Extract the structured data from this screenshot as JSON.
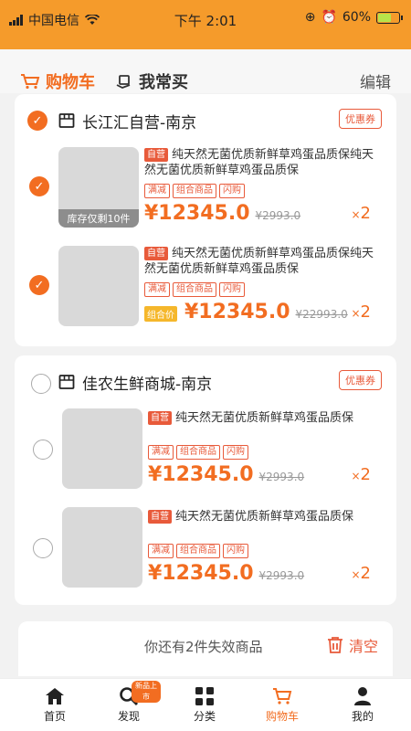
{
  "status_bar": {
    "carrier": "中国电信",
    "time": "下午 2:01",
    "battery": "60%"
  },
  "tabs": {
    "cart": "购物车",
    "often": "我常买",
    "edit": "编辑"
  },
  "shops": [
    {
      "name": "长江汇自营-南京",
      "coupon": "优惠券",
      "items": [
        {
          "badge": "自营",
          "title": "纯天然无菌优质新鲜草鸡蛋品质保纯天然无菌优质新鲜草鸡蛋品质保",
          "tags": [
            "满减",
            "组合商品",
            "闪购"
          ],
          "price": "¥12345.0",
          "old_price": "¥2993.0",
          "qty_x": "×",
          "qty": "2",
          "stock_tip": "库存仅剩10件"
        },
        {
          "badge": "自营",
          "title": "纯天然无菌优质新鲜草鸡蛋品质保纯天然无菌优质新鲜草鸡蛋品质保",
          "tags": [
            "满减",
            "组合商品",
            "闪购"
          ],
          "combo_label": "组合价",
          "price": "¥12345.0",
          "old_price": "¥22993.0",
          "qty_x": "×",
          "qty": "2"
        }
      ]
    },
    {
      "name": "佳农生鲜商城-南京",
      "coupon": "优惠券",
      "items": [
        {
          "badge": "自营",
          "title": "纯天然无菌优质新鲜草鸡蛋品质保",
          "tags": [
            "满减",
            "组合商品",
            "闪购"
          ],
          "price": "¥12345.0",
          "old_price": "¥2993.0",
          "qty_x": "×",
          "qty": "2"
        },
        {
          "badge": "自营",
          "title": "纯天然无菌优质新鲜草鸡蛋品质保",
          "tags": [
            "满减",
            "组合商品",
            "闪购"
          ],
          "price": "¥12345.0",
          "old_price": "¥2993.0",
          "qty_x": "×",
          "qty": "2"
        }
      ]
    }
  ],
  "invalid": {
    "text": "你还有2件失效商品",
    "clear": "清空"
  },
  "nav": {
    "home": "首页",
    "discover": "发现",
    "discover_badge": "新品上市",
    "category": "分类",
    "cart": "购物车",
    "mine": "我的"
  },
  "colors": {
    "accent": "#f26d21",
    "header": "#f59b2b",
    "tag_red": "#e85a3a"
  }
}
